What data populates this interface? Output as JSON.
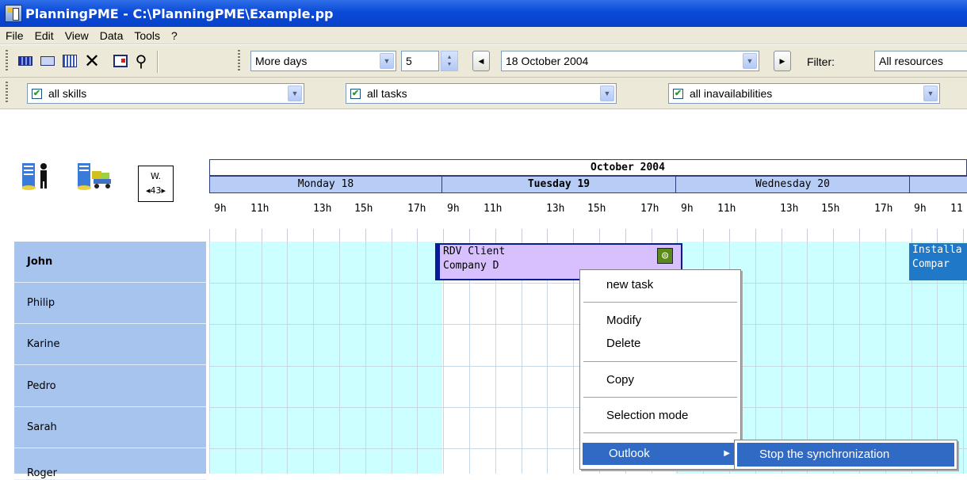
{
  "window": {
    "title": "PlanningPME - C:\\PlanningPME\\Example.pp"
  },
  "menu": [
    "File",
    "Edit",
    "View",
    "Data",
    "Tools",
    "?"
  ],
  "toolbar": {
    "view_mode": "More days",
    "days_count": "5",
    "date": "18  October  2004",
    "filter_label": "Filter:",
    "filter_value": "All resources"
  },
  "filters": {
    "skills": "all skills",
    "tasks": "all tasks",
    "inavailabilities": "all inavailabilities"
  },
  "calendar": {
    "week_label": "W.",
    "week_number": "43",
    "month": "October 2004",
    "days": [
      "Monday 18",
      "Tuesday 19",
      "Wednesday 20"
    ],
    "hours": [
      "9h",
      "11h",
      "13h",
      "15h",
      "17h"
    ],
    "partial_hours": [
      "9h",
      "11"
    ]
  },
  "resources": [
    "John",
    "Philip",
    "Karine",
    "Pedro",
    "Sarah",
    "Roger"
  ],
  "tasks": [
    {
      "line1": "RDV Client",
      "line2": "Company D"
    },
    {
      "line1": "Installa",
      "line2": "Compar"
    }
  ],
  "context_menu": {
    "items": [
      "new task",
      "Modify",
      "Delete",
      "Copy",
      "Selection mode",
      "Outlook"
    ],
    "submenu_item": "Stop the synchronization"
  },
  "colors": {
    "titlebar": "#0a4ad8",
    "toolbar_bg": "#ece9d8",
    "resource_col": "#a7c4ee",
    "day_header": "#b7cdf5",
    "weekday_bg": "#ccffff",
    "selection": "#316ac5",
    "task_purple": "#d8c0ff",
    "task_blue": "#1f78c8"
  }
}
